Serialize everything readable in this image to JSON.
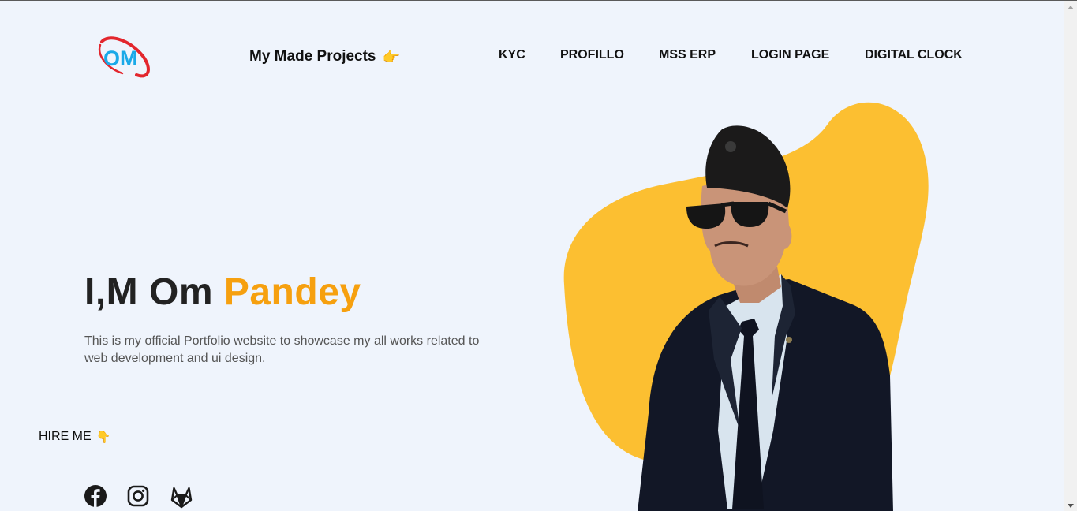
{
  "header": {
    "logo_text": "OM",
    "projects_label": "My Made Projects",
    "projects_emoji": "👉",
    "nav": [
      {
        "label": "KYC"
      },
      {
        "label": "PROFILLO"
      },
      {
        "label": "MSS ERP"
      },
      {
        "label": "LOGIN PAGE"
      },
      {
        "label": "DIGITAL CLOCK"
      }
    ]
  },
  "hero": {
    "title_prefix": "I,M Om ",
    "title_accent": "Pandey",
    "description": "This is my official Portfolio website to showcase my all works related to web development and ui design.",
    "hire_label": "HIRE ME",
    "hire_emoji": "👇"
  },
  "socials": [
    {
      "icon": "facebook-icon"
    },
    {
      "icon": "instagram-icon"
    },
    {
      "icon": "gitlab-icon"
    }
  ],
  "colors": {
    "background": "#eff4fc",
    "accent": "#f6a00f",
    "blob": "#fcbf31",
    "logo_blue": "#1aa9e8",
    "logo_red": "#e3262d"
  }
}
